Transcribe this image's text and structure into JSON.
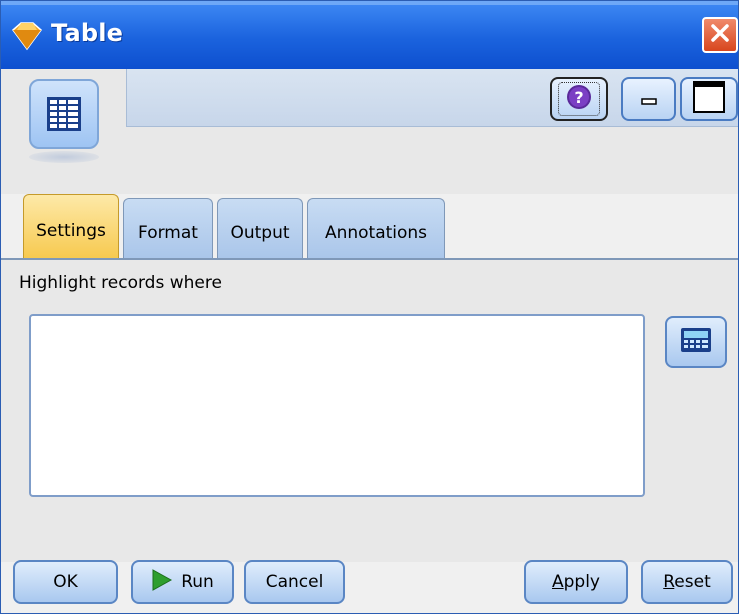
{
  "window": {
    "title": "Table",
    "close_icon": "close-icon",
    "title_icon": "diamond-node-icon"
  },
  "header": {
    "node_icon": "table-grid-icon",
    "help_icon": "help-question-icon",
    "minimize_icon": "minimize-icon",
    "maximize_icon": "maximize-icon"
  },
  "tabs": [
    {
      "label": "Settings",
      "active": true
    },
    {
      "label": "Format",
      "active": false
    },
    {
      "label": "Output",
      "active": false
    },
    {
      "label": "Annotations",
      "active": false
    }
  ],
  "settings": {
    "highlight_label": "Highlight records where",
    "expression_value": "",
    "calculator_icon": "expression-builder-icon"
  },
  "buttons": {
    "ok": "OK",
    "run": "Run",
    "cancel": "Cancel",
    "apply_prefix": "A",
    "apply_rest": "pply",
    "reset_prefix": "R",
    "reset_rest": "eset"
  },
  "colors": {
    "titlebar": "#1b63de",
    "active_tab": "#f7c94e",
    "inactive_tab": "#aac6ea",
    "close": "#d8461e",
    "run_arrow": "#2e9e2e"
  }
}
